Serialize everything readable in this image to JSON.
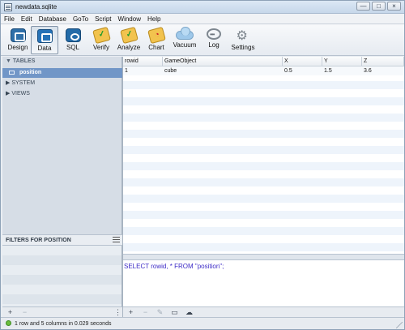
{
  "window": {
    "title": "newdata.sqlite"
  },
  "menubar": {
    "items": [
      "File",
      "Edit",
      "Database",
      "GoTo",
      "Script",
      "Window",
      "Help"
    ]
  },
  "toolbar": {
    "items": [
      {
        "label": "Design",
        "icon": "design-icon",
        "active": false
      },
      {
        "label": "Data",
        "icon": "data-icon",
        "active": true
      },
      {
        "label": "SQL",
        "icon": "sql-icon",
        "active": false
      },
      {
        "label": "Verify",
        "icon": "verify-icon",
        "active": false
      },
      {
        "label": "Analyze",
        "icon": "analyze-icon",
        "active": false
      },
      {
        "label": "Chart",
        "icon": "chart-icon",
        "active": false
      },
      {
        "label": "Vacuum",
        "icon": "vacuum-icon",
        "active": false
      },
      {
        "label": "Log",
        "icon": "log-icon",
        "active": false
      },
      {
        "label": "Settings",
        "icon": "settings-icon",
        "active": false
      }
    ]
  },
  "sidebar": {
    "tables_header": "TABLES",
    "tables": [
      {
        "label": "position",
        "selected": true
      }
    ],
    "system_label": "SYSTEM",
    "views_label": "VIEWS"
  },
  "filters": {
    "title": "FILTERS FOR POSITION"
  },
  "table": {
    "columns": [
      "rowid",
      "GameObject",
      "X",
      "Y",
      "Z"
    ],
    "rows": [
      [
        "1",
        "cube",
        "0.5",
        "1.5",
        "3.6"
      ]
    ]
  },
  "query": {
    "text": "SELECT rowid, * FROM \"position\";"
  },
  "status": {
    "text": "1 row and 5 columns in 0.029 seconds"
  },
  "colors": {
    "accent": "#7196c7",
    "status_ok": "#6bbd3d",
    "query_text": "#3d2cc7"
  }
}
